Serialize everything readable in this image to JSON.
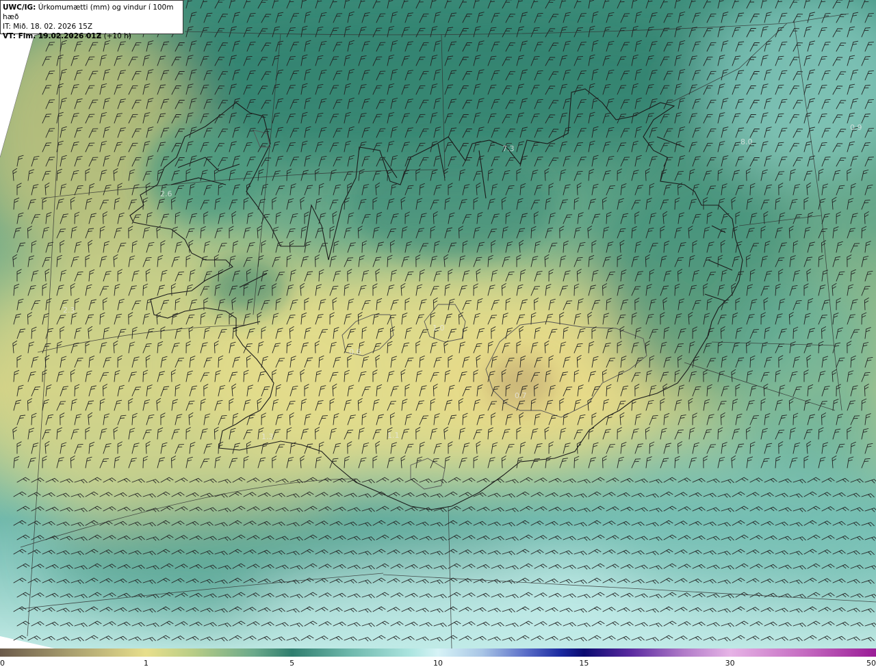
{
  "header": {
    "model": "UWC/IG:",
    "title": "Úrkomumætti (mm) og vindur í 100m hæð",
    "issue_label": "IT:",
    "issue_time": "Mið. 18. 02. 2026 15Z",
    "valid_label": "VT: Fim. 19.02.2026 01Z",
    "valid_offset": "(+10 h)"
  },
  "colorbar": {
    "ticks": [
      {
        "label": "0",
        "pos": 0.0
      },
      {
        "label": "1",
        "pos": 0.1667
      },
      {
        "label": "5",
        "pos": 0.3333
      },
      {
        "label": "10",
        "pos": 0.5
      },
      {
        "label": "15",
        "pos": 0.6667
      },
      {
        "label": "30",
        "pos": 0.8333
      },
      {
        "label": "50",
        "pos": 1.0
      }
    ],
    "colors": [
      "#6b5a4a",
      "#a89e6e",
      "#e7df8c",
      "#b9cd86",
      "#6aa98a",
      "#2f7e6e",
      "#6fb9ad",
      "#aee6e1",
      "#d6f3f6",
      "#a9c6e6",
      "#5a6ec8",
      "#1b2aa0",
      "#0a0a70",
      "#5a2aa0",
      "#b07ac8",
      "#e6b3e6",
      "#c46ac0",
      "#9a1c96"
    ],
    "color_stops": [
      0.0,
      0.08,
      0.1667,
      0.22,
      0.29,
      0.3333,
      0.4,
      0.47,
      0.5,
      0.55,
      0.6,
      0.64,
      0.6667,
      0.72,
      0.78,
      0.8333,
      0.92,
      1.0
    ]
  },
  "map_labels": [
    {
      "text": "2.6"
    },
    {
      "text": "2.3"
    },
    {
      "text": "7.3"
    },
    {
      "text": "8.0"
    },
    {
      "text": "1.3"
    },
    {
      "text": "1.0"
    },
    {
      "text": "0.6"
    },
    {
      "text": "0.7"
    },
    {
      "text": "1.1"
    },
    {
      "text": "0.9"
    }
  ],
  "colors": {
    "yellow": "#e2d98a",
    "teal_dark": "#2f7e6e",
    "teal_mid": "#6fb9ad",
    "cyan_light": "#bfe9e4",
    "coast": "#1a1a1a",
    "grid": "#333333"
  }
}
